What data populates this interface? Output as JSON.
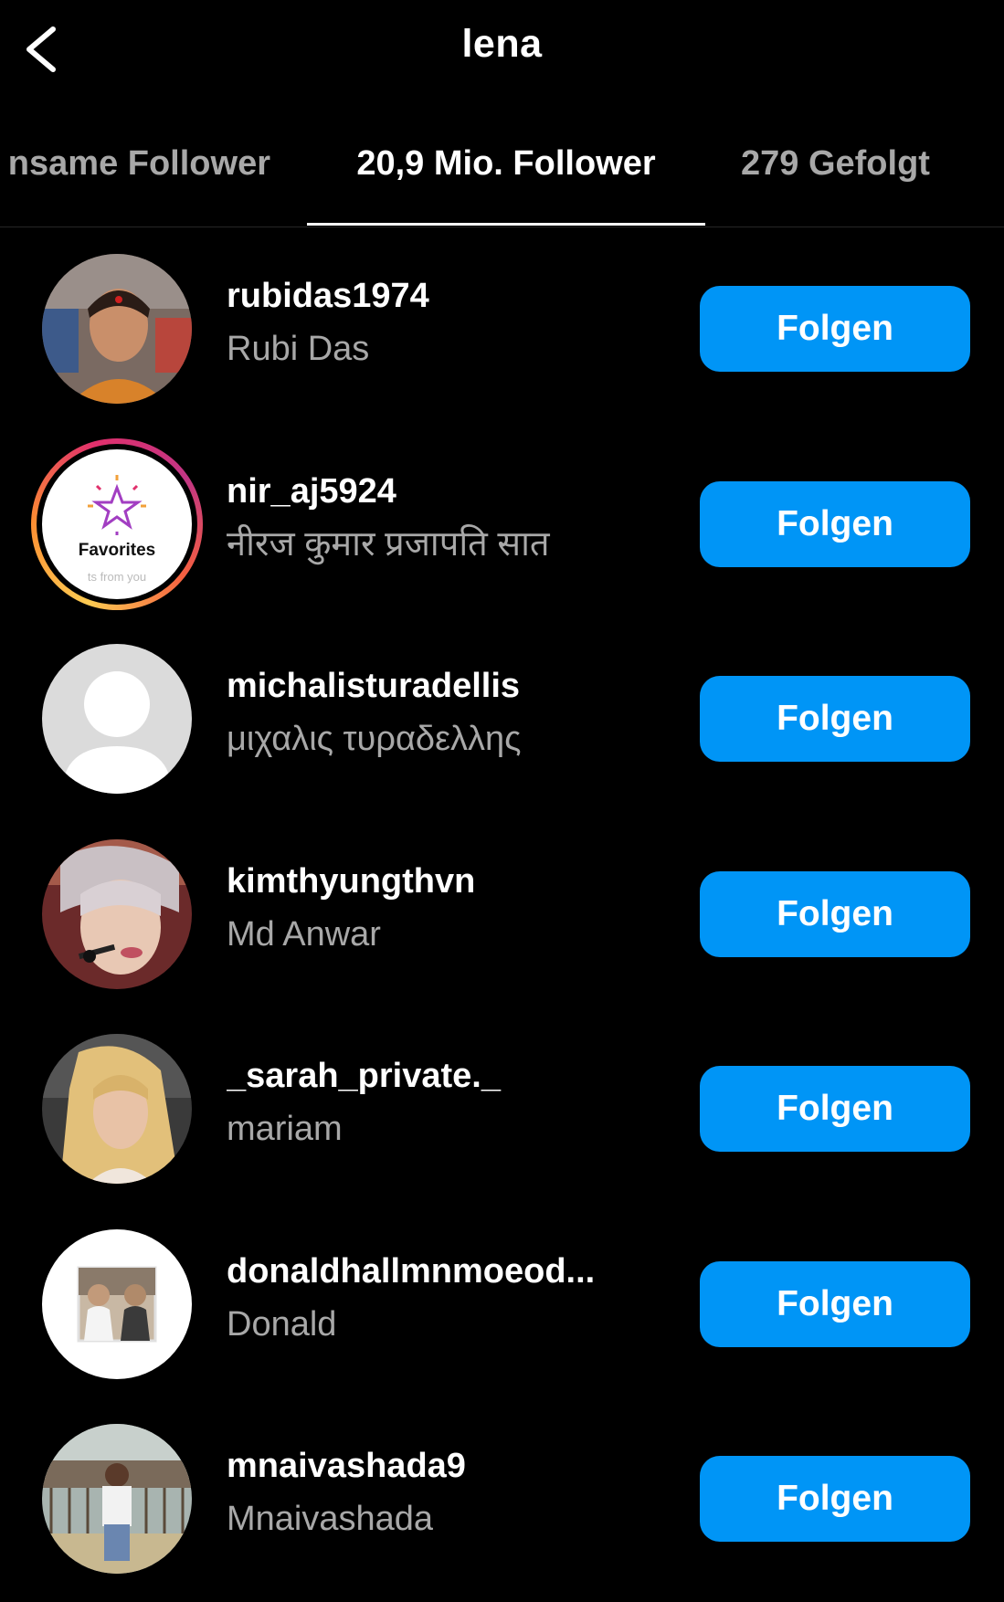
{
  "header": {
    "title": "lena",
    "back_icon": "chevron-left-icon"
  },
  "tabs": [
    {
      "label": "nsame Follower",
      "active": false
    },
    {
      "label": "20,9 Mio. Follower",
      "active": true
    },
    {
      "label": "279 Gefolgt",
      "active": false
    }
  ],
  "colors": {
    "background": "#000000",
    "primary_text": "#ffffff",
    "secondary_text": "#a8a8a8",
    "follow_button": "#0095f6",
    "divider": "#262626"
  },
  "follow_label": "Folgen",
  "followers": [
    {
      "username": "rubidas1974",
      "full_name": "Rubi Das",
      "button": "Folgen"
    },
    {
      "username": "nir_aj5924",
      "full_name": "नीरज कुमार प्रजापति सात",
      "button": "Folgen",
      "story_ring": true,
      "avatar_text": "Favorites",
      "avatar_subtext": "ts from you"
    },
    {
      "username": "michalisturadellis",
      "full_name": "μιχαλις τυραδελλης",
      "button": "Folgen"
    },
    {
      "username": "kimthyungthvn",
      "full_name": "Md Anwar",
      "button": "Folgen"
    },
    {
      "username": "_sarah_private._",
      "full_name": "mariam",
      "button": "Folgen"
    },
    {
      "username": "donaldhallmnmoeod...",
      "full_name": "Donald",
      "button": "Folgen"
    },
    {
      "username": "mnaivashada9",
      "full_name": "Mnaivashada",
      "button": "Folgen"
    }
  ]
}
